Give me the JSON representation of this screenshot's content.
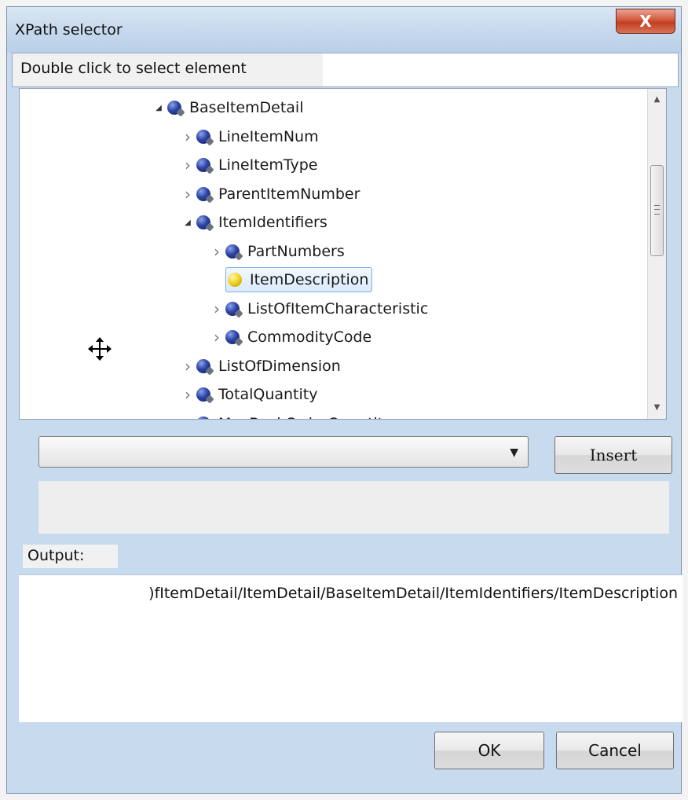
{
  "window": {
    "title": "XPath selector",
    "close_glyph": "X"
  },
  "hint": "Double click to select element",
  "tree": {
    "items": [
      {
        "label": "BaseItemDetail",
        "depth": 0,
        "expanded": true,
        "selected": false
      },
      {
        "label": "LineItemNum",
        "depth": 1,
        "expanded": false,
        "selected": false
      },
      {
        "label": "LineItemType",
        "depth": 1,
        "expanded": false,
        "selected": false
      },
      {
        "label": "ParentItemNumber",
        "depth": 1,
        "expanded": false,
        "selected": false
      },
      {
        "label": "ItemIdentifiers",
        "depth": 1,
        "expanded": true,
        "selected": false
      },
      {
        "label": "PartNumbers",
        "depth": 2,
        "expanded": false,
        "selected": false
      },
      {
        "label": "ItemDescription",
        "depth": 2,
        "expanded": null,
        "selected": true
      },
      {
        "label": "ListOfItemCharacteristic",
        "depth": 2,
        "expanded": false,
        "selected": false
      },
      {
        "label": "CommodityCode",
        "depth": 2,
        "expanded": false,
        "selected": false
      },
      {
        "label": "ListOfDimension",
        "depth": 1,
        "expanded": false,
        "selected": false
      },
      {
        "label": "TotalQuantity",
        "depth": 1,
        "expanded": false,
        "selected": false
      },
      {
        "label": "MaxBackOrderQuantity",
        "depth": 1,
        "expanded": false,
        "selected": false
      }
    ]
  },
  "combo": {
    "value": ""
  },
  "buttons": {
    "insert": "Insert",
    "ok": "OK",
    "cancel": "Cancel"
  },
  "output": {
    "label": "Output:",
    "value": ")fItemDetail/ItemDetail/BaseItemDetail/ItemIdentifiers/ItemDescription"
  },
  "colors": {
    "selected_icon": "#f0d020",
    "node_icon": "#2d43a6",
    "title_bar": "#c6d8ed"
  }
}
